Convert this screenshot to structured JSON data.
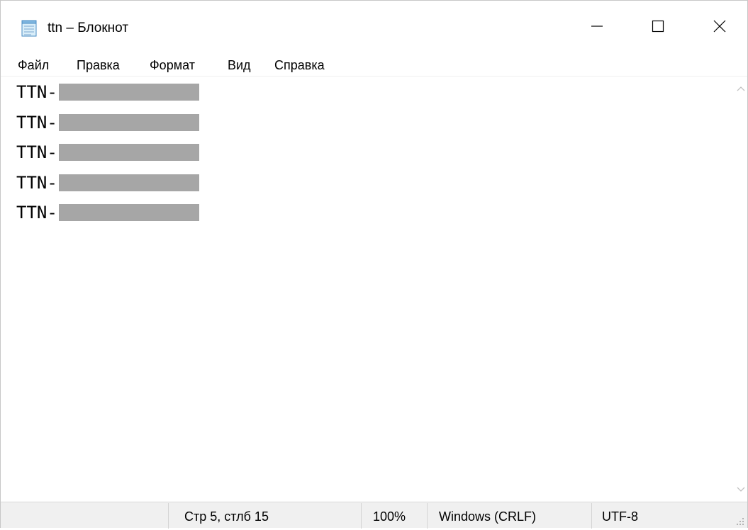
{
  "window": {
    "title": "ttn – Блокнот",
    "app_icon": "notepad-icon",
    "controls": {
      "minimize": "minimize-icon",
      "maximize": "maximize-icon",
      "close": "close-icon"
    }
  },
  "menu": {
    "items": [
      "Файл",
      "Правка",
      "Формат",
      "Вид",
      "Справка"
    ]
  },
  "editor": {
    "lines": [
      {
        "prefix": "TTN-",
        "redacted": true
      },
      {
        "prefix": "TTN-",
        "redacted": true
      },
      {
        "prefix": "TTN-",
        "redacted": true
      },
      {
        "prefix": "TTN-",
        "redacted": true
      },
      {
        "prefix": "TTN-",
        "redacted": true
      }
    ]
  },
  "scrollbar": {
    "up": "chevron-up-icon",
    "down": "chevron-down-icon"
  },
  "statusbar": {
    "position": "Стр 5, стлб 15",
    "zoom": "100%",
    "line_ending": "Windows (CRLF)",
    "encoding": "UTF-8"
  },
  "colors": {
    "redaction": "#a6a6a6",
    "statusbar_bg": "#f0f0f0"
  }
}
